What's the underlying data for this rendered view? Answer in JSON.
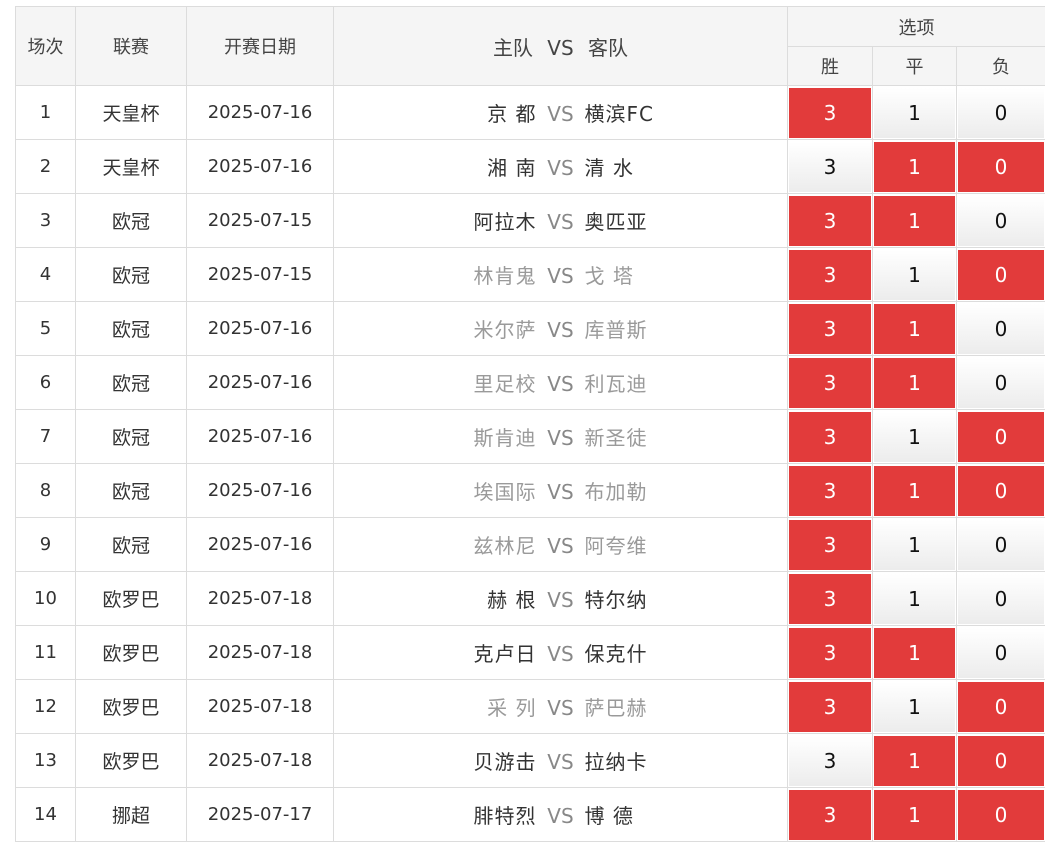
{
  "header": {
    "col_index": "场次",
    "col_league": "联赛",
    "col_date": "开赛日期",
    "col_match_home": "主队",
    "col_match_vs": "VS",
    "col_match_away": "客队",
    "col_options": "选项",
    "opt_win": "胜",
    "opt_draw": "平",
    "opt_loss": "负"
  },
  "colors": {
    "selected": "#e23b3b",
    "dim_text": "#9a9a9a"
  },
  "rows": [
    {
      "idx": "1",
      "league": "天皇杯",
      "date": "2025-07-16",
      "home": "京 都",
      "vs": "VS",
      "away": "横滨FC",
      "dim": false,
      "win": "3",
      "draw": "1",
      "loss": "0",
      "sel": [
        true,
        false,
        false
      ]
    },
    {
      "idx": "2",
      "league": "天皇杯",
      "date": "2025-07-16",
      "home": "湘 南",
      "vs": "VS",
      "away": "清 水",
      "dim": false,
      "win": "3",
      "draw": "1",
      "loss": "0",
      "sel": [
        false,
        true,
        true
      ]
    },
    {
      "idx": "3",
      "league": "欧冠",
      "date": "2025-07-15",
      "home": "阿拉木",
      "vs": "VS",
      "away": "奥匹亚",
      "dim": false,
      "win": "3",
      "draw": "1",
      "loss": "0",
      "sel": [
        true,
        true,
        false
      ]
    },
    {
      "idx": "4",
      "league": "欧冠",
      "date": "2025-07-15",
      "home": "林肯鬼",
      "vs": "VS",
      "away": "戈 塔",
      "dim": true,
      "win": "3",
      "draw": "1",
      "loss": "0",
      "sel": [
        true,
        false,
        true
      ]
    },
    {
      "idx": "5",
      "league": "欧冠",
      "date": "2025-07-16",
      "home": "米尔萨",
      "vs": "VS",
      "away": "库普斯",
      "dim": true,
      "win": "3",
      "draw": "1",
      "loss": "0",
      "sel": [
        true,
        true,
        false
      ]
    },
    {
      "idx": "6",
      "league": "欧冠",
      "date": "2025-07-16",
      "home": "里足校",
      "vs": "VS",
      "away": "利瓦迪",
      "dim": true,
      "win": "3",
      "draw": "1",
      "loss": "0",
      "sel": [
        true,
        true,
        false
      ]
    },
    {
      "idx": "7",
      "league": "欧冠",
      "date": "2025-07-16",
      "home": "斯肯迪",
      "vs": "VS",
      "away": "新圣徒",
      "dim": true,
      "win": "3",
      "draw": "1",
      "loss": "0",
      "sel": [
        true,
        false,
        true
      ]
    },
    {
      "idx": "8",
      "league": "欧冠",
      "date": "2025-07-16",
      "home": "埃国际",
      "vs": "VS",
      "away": "布加勒",
      "dim": true,
      "win": "3",
      "draw": "1",
      "loss": "0",
      "sel": [
        true,
        true,
        true
      ]
    },
    {
      "idx": "9",
      "league": "欧冠",
      "date": "2025-07-16",
      "home": "兹林尼",
      "vs": "VS",
      "away": "阿夸维",
      "dim": true,
      "win": "3",
      "draw": "1",
      "loss": "0",
      "sel": [
        true,
        false,
        false
      ]
    },
    {
      "idx": "10",
      "league": "欧罗巴",
      "date": "2025-07-18",
      "home": "赫 根",
      "vs": "VS",
      "away": "特尔纳",
      "dim": false,
      "win": "3",
      "draw": "1",
      "loss": "0",
      "sel": [
        true,
        false,
        false
      ]
    },
    {
      "idx": "11",
      "league": "欧罗巴",
      "date": "2025-07-18",
      "home": "克卢日",
      "vs": "VS",
      "away": "保克什",
      "dim": false,
      "win": "3",
      "draw": "1",
      "loss": "0",
      "sel": [
        true,
        true,
        false
      ]
    },
    {
      "idx": "12",
      "league": "欧罗巴",
      "date": "2025-07-18",
      "home": "采 列",
      "vs": "VS",
      "away": "萨巴赫",
      "dim": true,
      "win": "3",
      "draw": "1",
      "loss": "0",
      "sel": [
        true,
        false,
        true
      ]
    },
    {
      "idx": "13",
      "league": "欧罗巴",
      "date": "2025-07-18",
      "home": "贝游击",
      "vs": "VS",
      "away": "拉纳卡",
      "dim": false,
      "win": "3",
      "draw": "1",
      "loss": "0",
      "sel": [
        false,
        true,
        true
      ]
    },
    {
      "idx": "14",
      "league": "挪超",
      "date": "2025-07-17",
      "home": "腓特烈",
      "vs": "VS",
      "away": "博 德",
      "dim": false,
      "win": "3",
      "draw": "1",
      "loss": "0",
      "sel": [
        true,
        true,
        true
      ]
    }
  ]
}
